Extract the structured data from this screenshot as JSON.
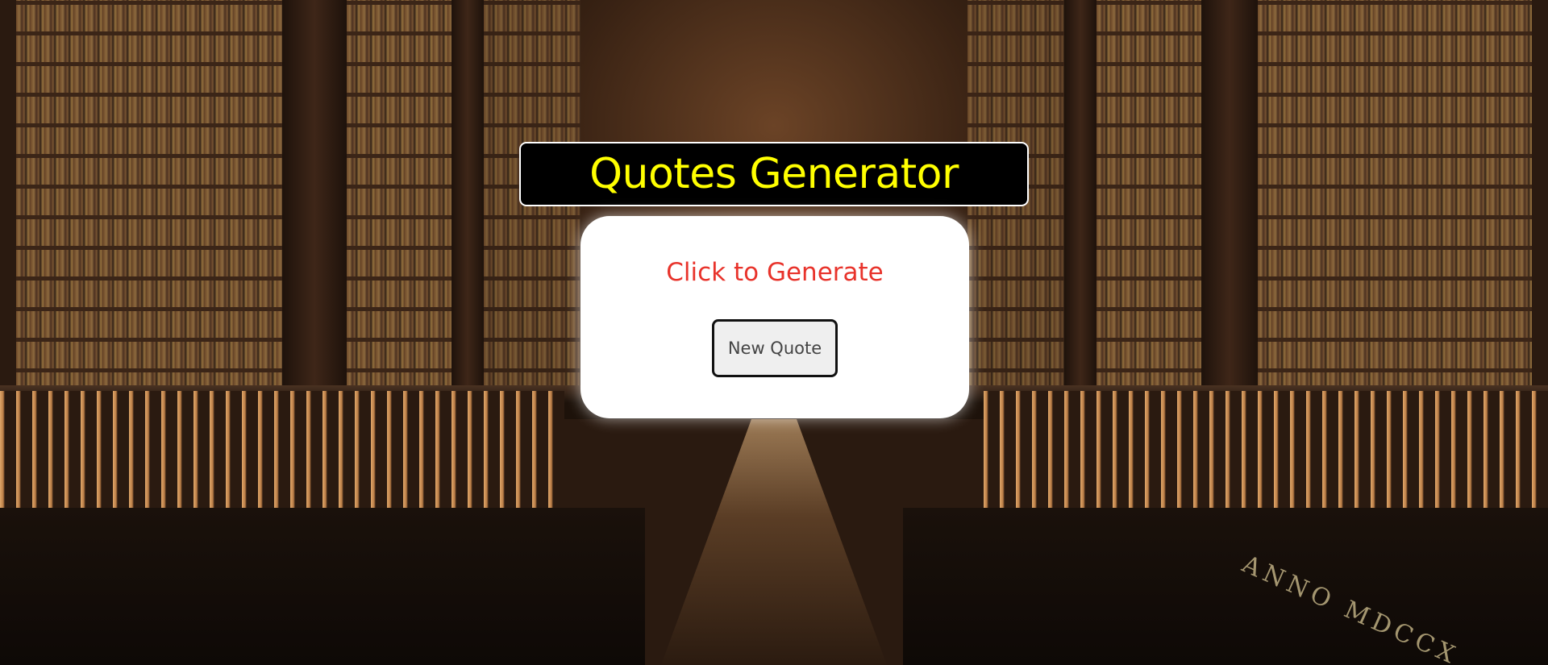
{
  "header": {
    "title": "Quotes Generator"
  },
  "quote_card": {
    "quote_text": "Click to Generate",
    "button_label": "New Quote"
  },
  "background": {
    "inscription": "ANNO MDCCX"
  },
  "colors": {
    "title_text": "#ffff00",
    "title_background": "#000000",
    "quote_text": "#e8332b",
    "card_background": "#ffffff",
    "button_background": "#efefef"
  }
}
